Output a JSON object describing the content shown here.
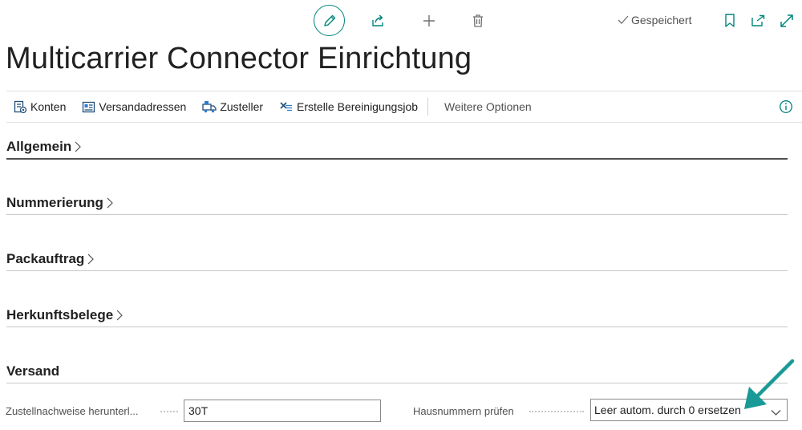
{
  "toolbar": {
    "edit_icon": "pencil-icon",
    "share_icon": "share-icon",
    "new_icon": "plus-icon",
    "delete_icon": "trash-icon",
    "saved_label": "Gespeichert",
    "saved_icon": "checkmark-icon",
    "bookmark_icon": "bookmark-icon",
    "popout_icon": "open-in-new-window-icon",
    "expand_icon": "expand-diagonal-icon"
  },
  "page": {
    "title": "Multicarrier Connector Einrichtung"
  },
  "actions": {
    "items": [
      {
        "label": "Konten",
        "icon": "accounts-icon"
      },
      {
        "label": "Versandadressen",
        "icon": "addresses-icon"
      },
      {
        "label": "Zusteller",
        "icon": "carrier-icon"
      },
      {
        "label": "Erstelle Bereinigungsjob",
        "icon": "cleanup-job-icon"
      }
    ],
    "more_options": "Weitere Optionen",
    "info_icon": "info-icon"
  },
  "sections": [
    {
      "title": "Allgemein",
      "collapsed": true
    },
    {
      "title": "Nummerierung",
      "collapsed": true
    },
    {
      "title": "Packauftrag",
      "collapsed": true
    },
    {
      "title": "Herkunftsbelege",
      "collapsed": true
    },
    {
      "title": "Versand",
      "collapsed": false
    }
  ],
  "versand": {
    "delivery_proof_label": "Zustellnachweise herunterl...",
    "delivery_proof_value": "30T",
    "house_number_label": "Hausnummern prüfen",
    "house_number_value": "Leer autom. durch 0 ersetzen"
  },
  "colors": {
    "accent": "#00857d",
    "annotation_arrow": "#1a9a96",
    "text": "#212121",
    "muted": "#505050"
  }
}
